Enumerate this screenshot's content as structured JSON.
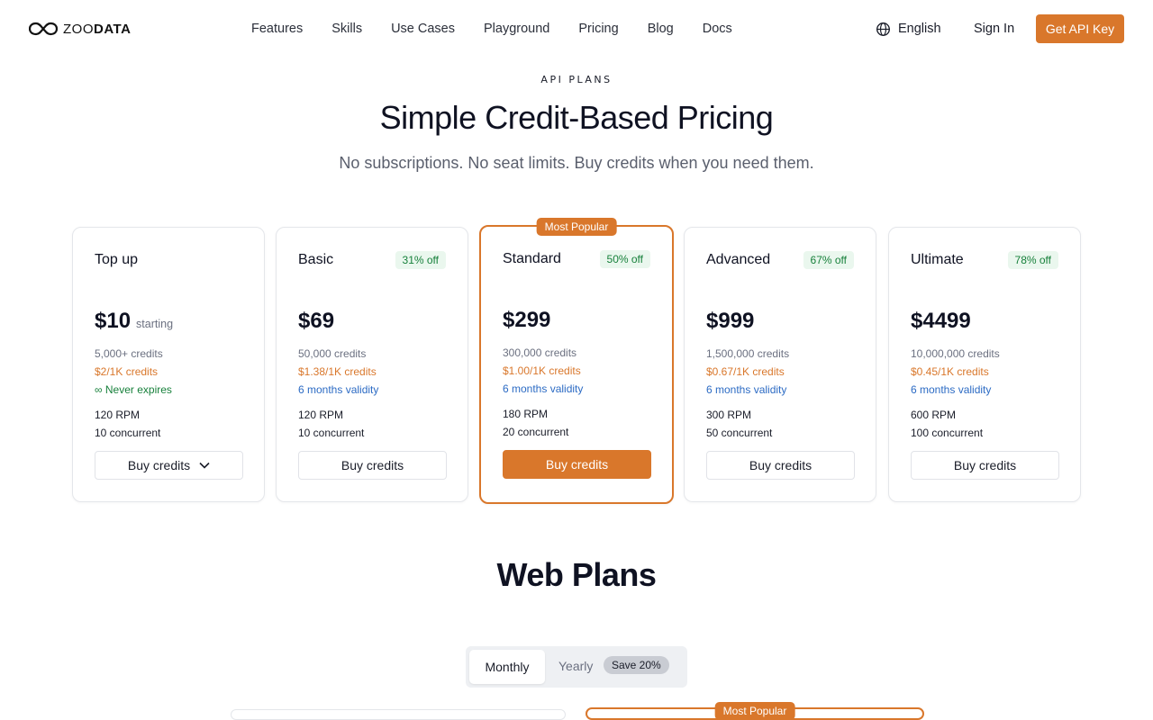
{
  "header": {
    "logo": {
      "light": "ZOO",
      "bold": "DATA"
    },
    "nav": [
      "Features",
      "Skills",
      "Use Cases",
      "Playground",
      "Pricing",
      "Blog",
      "Docs"
    ],
    "language": "English",
    "sign_in": "Sign In",
    "cta": "Get API Key"
  },
  "hero": {
    "eyebrow": "API PLANS",
    "title": "Simple Credit-Based Pricing",
    "subtitle": "No subscriptions. No seat limits. Buy credits when you need them."
  },
  "plans": [
    {
      "name": "Top up",
      "discount": "",
      "price": "$10",
      "price_note": "starting",
      "credits": "5,000+ credits",
      "rate": "$2/1K credits",
      "validity": "Never expires",
      "rpm": "120 RPM",
      "concurrent": "10 concurrent",
      "button": "Buy credits",
      "badge": ""
    },
    {
      "name": "Basic",
      "discount": "31% off",
      "price": "$69",
      "price_note": "",
      "credits": "50,000 credits",
      "rate": "$1.38/1K credits",
      "validity": "6 months validity",
      "rpm": "120 RPM",
      "concurrent": "10 concurrent",
      "button": "Buy credits",
      "badge": ""
    },
    {
      "name": "Standard",
      "discount": "50% off",
      "price": "$299",
      "price_note": "",
      "credits": "300,000 credits",
      "rate": "$1.00/1K credits",
      "validity": "6 months validity",
      "rpm": "180 RPM",
      "concurrent": "20 concurrent",
      "button": "Buy credits",
      "badge": "Most Popular"
    },
    {
      "name": "Advanced",
      "discount": "67% off",
      "price": "$999",
      "price_note": "",
      "credits": "1,500,000 credits",
      "rate": "$0.67/1K credits",
      "validity": "6 months validity",
      "rpm": "300 RPM",
      "concurrent": "50 concurrent",
      "button": "Buy credits",
      "badge": ""
    },
    {
      "name": "Ultimate",
      "discount": "78% off",
      "price": "$4499",
      "price_note": "",
      "credits": "10,000,000 credits",
      "rate": "$0.45/1K credits",
      "validity": "6 months validity",
      "rpm": "600 RPM",
      "concurrent": "100 concurrent",
      "button": "Buy credits",
      "badge": ""
    }
  ],
  "web": {
    "title": "Web Plans",
    "toggle": {
      "monthly": "Monthly",
      "yearly": "Yearly",
      "save": "Save 20%"
    },
    "popular_badge": "Most Popular"
  },
  "colors": {
    "accent": "#d9772b",
    "discount_green": "#17803b",
    "validity_blue": "#2c6bc4"
  }
}
